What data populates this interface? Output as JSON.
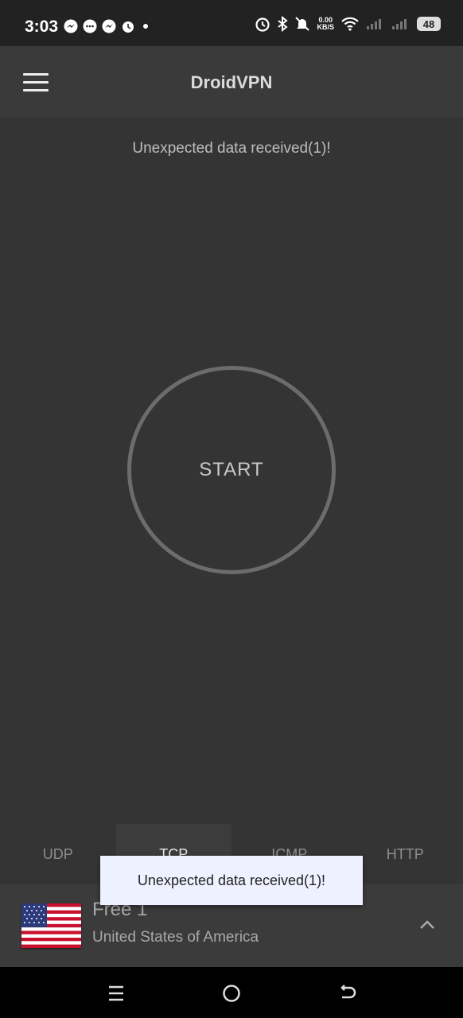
{
  "status_bar": {
    "time": "3:03",
    "net_speed_value": "0.00",
    "net_speed_unit": "KB/S",
    "battery": "48",
    "icons": [
      "messenger-icon",
      "chat-icon",
      "messenger-icon",
      "alarm-icon",
      "alarm-icon",
      "bluetooth-icon",
      "mute-icon",
      "wifi-icon",
      "signal-icon",
      "signal-icon",
      "battery-icon"
    ]
  },
  "app_bar": {
    "title": "DroidVPN"
  },
  "status_message": "Unexpected data received(1)!",
  "start_button": {
    "label": "START"
  },
  "protocol_tabs": [
    {
      "label": "UDP",
      "active": false
    },
    {
      "label": "TCP",
      "active": true
    },
    {
      "label": "ICMP",
      "active": false
    },
    {
      "label": "HTTP",
      "active": false
    }
  ],
  "server": {
    "name": "Free 1",
    "country": "United States of America",
    "flag": "us-flag-icon"
  },
  "toast": {
    "message": "Unexpected data received(1)!"
  },
  "nav_bar": {
    "buttons": [
      "recents-icon",
      "home-icon",
      "back-icon"
    ]
  },
  "colors": {
    "background": "#343434",
    "app_bar": "#3a3a3a",
    "status_bar": "#222222",
    "ring": "#6c6c6c",
    "toast_bg": "#eef1ff"
  }
}
